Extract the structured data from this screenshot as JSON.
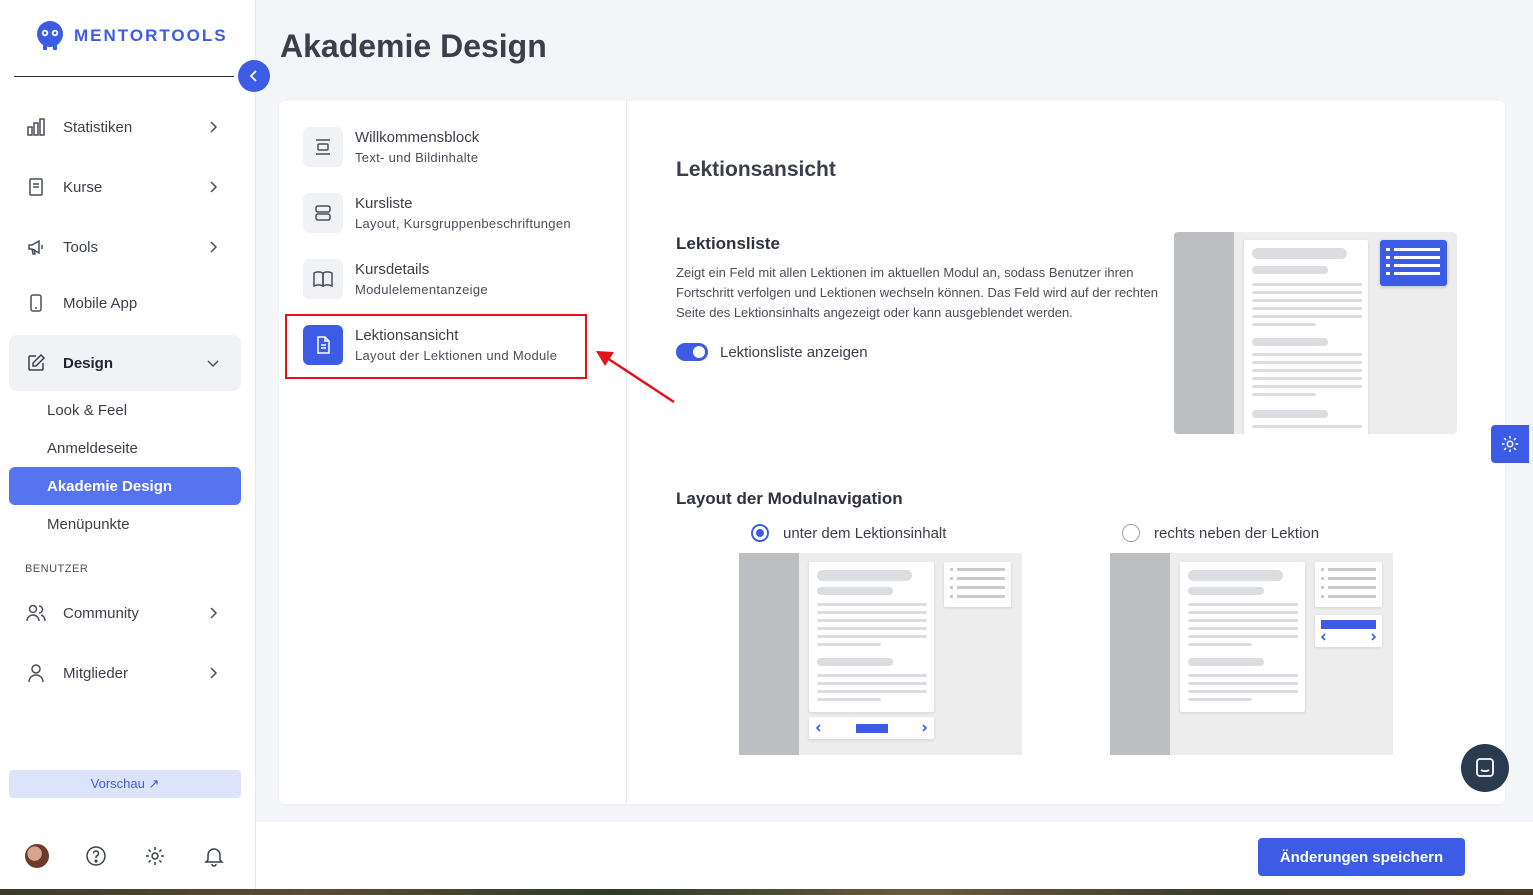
{
  "brand": {
    "name": "MENTORTOOLS",
    "accent": "#3d5ce6",
    "highlight": "#e3131b"
  },
  "page": {
    "title": "Akademie Design"
  },
  "sidebar": {
    "items": [
      {
        "label": "Statistiken",
        "icon": "bar-chart-icon"
      },
      {
        "label": "Kurse",
        "icon": "book-icon"
      },
      {
        "label": "Tools",
        "icon": "megaphone-icon"
      },
      {
        "label": "Mobile App",
        "icon": "phone-icon"
      },
      {
        "label": "Design",
        "icon": "edit-icon"
      }
    ],
    "design_sub": [
      {
        "label": "Look & Feel"
      },
      {
        "label": "Anmeldeseite"
      },
      {
        "label": "Akademie Design"
      },
      {
        "label": "Menüpunkte"
      }
    ],
    "section_users": "BENUTZER",
    "user_items": [
      {
        "label": "Community",
        "icon": "users-icon"
      },
      {
        "label": "Mitglieder",
        "icon": "user-icon"
      }
    ],
    "preview_label": "Vorschau ↗"
  },
  "settings_menu": [
    {
      "title": "Willkommensblock",
      "subtitle": "Text- und Bildinhalte",
      "icon": "align-center-icon"
    },
    {
      "title": "Kursliste",
      "subtitle": "Layout, Kursgruppenbeschriftungen",
      "icon": "list-layout-icon"
    },
    {
      "title": "Kursdetails",
      "subtitle": "Modulelementanzeige",
      "icon": "open-book-icon"
    },
    {
      "title": "Lektionsansicht",
      "subtitle": "Layout der Lektionen und Module",
      "icon": "document-icon"
    }
  ],
  "content": {
    "section_title": "Lektionsansicht",
    "lesson_list": {
      "title": "Lektionsliste",
      "description": "Zeigt ein Feld mit allen Lektionen im aktuellen Modul an, sodass Benutzer ihren Fortschritt verfolgen und Lektionen wechseln können. Das Feld wird auf der rechten Seite des Lektionsinhalts angezeigt oder kann ausgeblendet werden.",
      "toggle_label": "Lektionsliste anzeigen",
      "toggle_on": true
    },
    "module_nav": {
      "title": "Layout der Modulnavigation",
      "options": [
        {
          "label": "unter dem Lektionsinhalt",
          "selected": true
        },
        {
          "label": "rechts neben der Lektion",
          "selected": false
        }
      ]
    }
  },
  "footer": {
    "save_label": "Änderungen speichern"
  }
}
